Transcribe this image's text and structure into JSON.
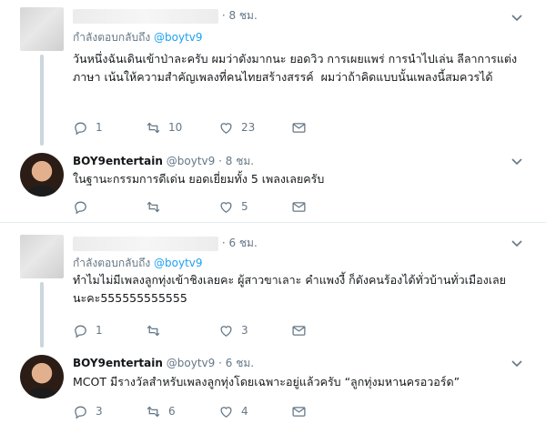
{
  "tweets": [
    {
      "type": "reply",
      "author_blurred": true,
      "time": "· 8 ชม.",
      "replying_prefix": "กำลังตอบกลับถึง",
      "replying_to": "@boytv9",
      "text": "วันหนึ่งฉันเดินเข้าป่าละครับ ผมว่าดังมากนะ ยอดวิว การเผยแพร่ การนำไปเล่น ลีลาการแต่งภาษา เน้นให้ความสำคัญเพลงที่คนไทยสร้างสรรค์  ผมว่าถ้าคิดแบบนั้นเพลงนี้สมควรได้",
      "actions": {
        "reply": "1",
        "retweet": "10",
        "like": "23"
      }
    },
    {
      "type": "answer",
      "name": "BOY9entertain",
      "handle": "@boytv9",
      "time": "· 8 ชม.",
      "text": "ในฐานะกรรมการดีเด่น ยอดเยี่ยมทั้ง 5 เพลงเลยครับ",
      "actions": {
        "reply": "",
        "retweet": "",
        "like": "5"
      }
    },
    {
      "type": "reply",
      "author_blurred": true,
      "time": "· 6 ชม.",
      "replying_prefix": "กำลังตอบกลับถึง",
      "replying_to": "@boytv9",
      "text": "ทำไมไม่มีเพลงลูกทุ่งเข้าชิงเลยคะ ผู้สาวขาเลาะ คำแพงงี้ ก็ดังคนร้องได้ทั่วบ้านทั่วเมืองเลยนะคะ555555555555",
      "actions": {
        "reply": "1",
        "retweet": "",
        "like": "3"
      }
    },
    {
      "type": "answer",
      "name": "BOY9entertain",
      "handle": "@boytv9",
      "time": "· 6 ชม.",
      "text": "MCOT มีรางวัลสำหรับเพลงลูกทุ่งโดยเฉพาะอยู่แล้วครับ “ลูกทุ่งมหานครอวอร์ด”",
      "actions": {
        "reply": "3",
        "retweet": "6",
        "like": "4"
      }
    }
  ],
  "icons": {
    "reply": "reply-icon",
    "retweet": "retweet-icon",
    "like": "heart-icon",
    "dm": "envelope-icon",
    "caret": "chevron-down-icon"
  },
  "colors": {
    "link": "#1da1f2",
    "secondary_text": "#657786",
    "thread_line": "#ccd6dd",
    "divider": "#e6ecf0"
  }
}
